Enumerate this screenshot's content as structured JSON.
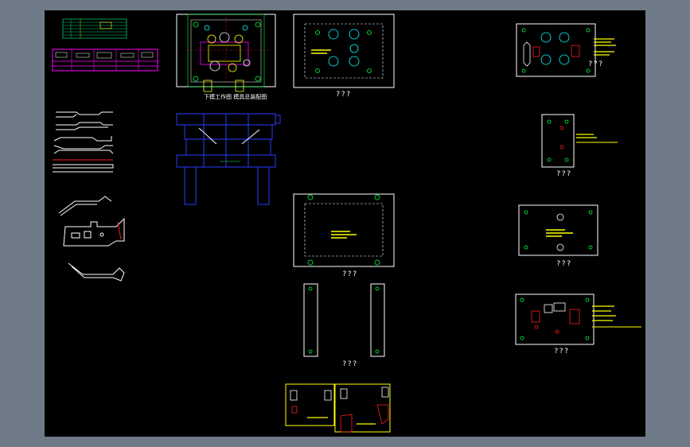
{
  "drawing": {
    "caption_main_plate": "???",
    "caption_lower_plate": "???",
    "caption_bars": "???",
    "caption_right_1": "???",
    "caption_right_2": "???",
    "caption_right_3": "???",
    "caption_right_4": "???",
    "assembly_note": "下模工作图 模具总装配图"
  },
  "colors": {
    "background": "#000000",
    "frame": "#6e7a87",
    "line_white": "#ffffff",
    "line_blue": "#2a3cff",
    "line_yellow": "#ffff00",
    "line_green": "#00ff40",
    "line_magenta": "#ff00ff",
    "line_red": "#ff2020",
    "line_cyan": "#00ffff"
  }
}
